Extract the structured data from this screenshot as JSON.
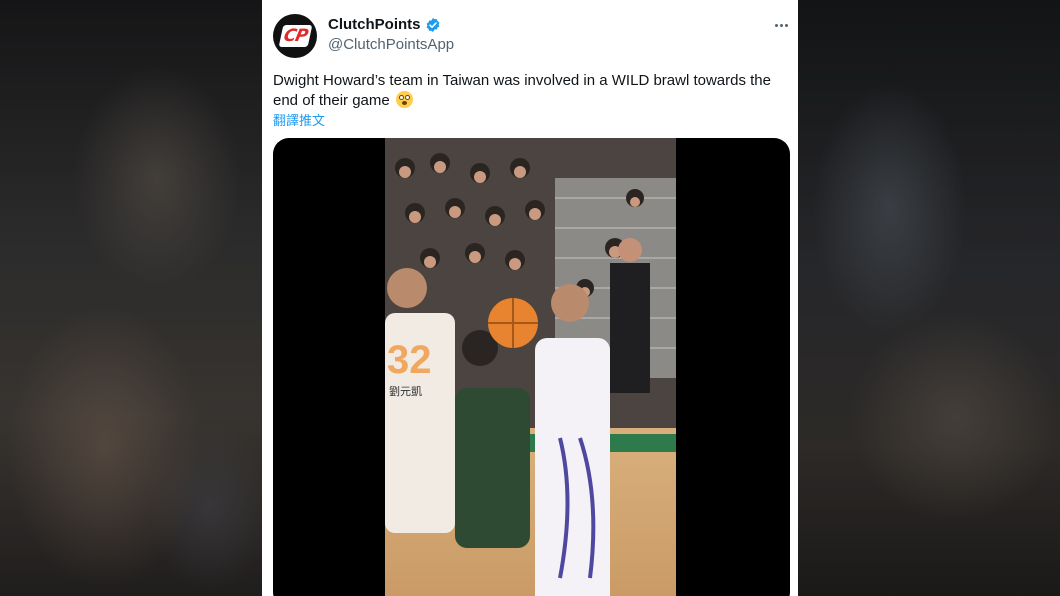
{
  "tweet": {
    "author": {
      "display_name": "ClutchPoints",
      "handle": "@ClutchPointsApp",
      "avatar_text": "CP",
      "verified": true
    },
    "text": "Dwight Howard’s team in Taiwan was involved in a WILD brawl towards the end of their game",
    "emoji": "flushed-face",
    "translate_label": "翻譯推文",
    "media": {
      "type": "video",
      "jersey_number": "32",
      "jersey_name": "劉元凱"
    }
  },
  "colors": {
    "link": "#1d9bf0",
    "verified": "#1d9bf0",
    "text": "#0f1419",
    "secondary": "#536471",
    "avatar_bg": "#111111",
    "avatar_accent": "#e02a2a"
  }
}
